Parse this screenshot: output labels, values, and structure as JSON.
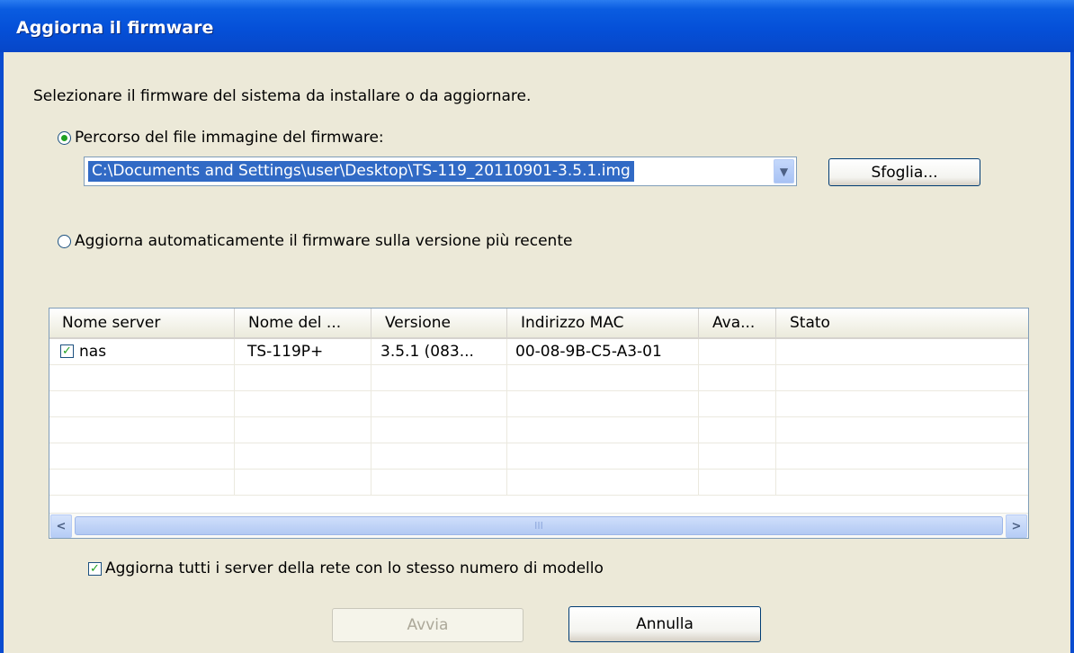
{
  "window": {
    "title": "Aggiorna il firmware"
  },
  "instruction": "Selezionare il firmware del sistema da installare o da aggiornare.",
  "option_file": {
    "label": "Percorso del file immagine del firmware:",
    "selected": true
  },
  "file_path": {
    "value": "C:\\Documents and Settings\\user\\Desktop\\TS-119_20110901-3.5.1.img"
  },
  "browse_button": {
    "label": "Sfoglia..."
  },
  "option_auto": {
    "label": "Aggiorna automaticamente il firmware sulla versione più recente",
    "selected": false
  },
  "table": {
    "columns": [
      "Nome server",
      "Nome del ...",
      "Versione",
      "Indirizzo MAC",
      "Ava...",
      "Stato"
    ],
    "rows": [
      {
        "checked": true,
        "server": "nas",
        "model": "TS-119P+",
        "version": "3.5.1 (083...",
        "mac": "00-08-9B-C5-A3-01",
        "ava": "",
        "status": ""
      }
    ],
    "scroll_thumb_grip": "III"
  },
  "update_all": {
    "label": "Aggiorna tutti i server della rete con lo stesso numero di modello",
    "checked": true
  },
  "buttons": {
    "start": "Avvia",
    "cancel": "Annulla"
  },
  "colors": {
    "titlebar": "#0550d8",
    "face": "#ece9d8",
    "selection": "#316ac5",
    "check": "#21a121"
  }
}
